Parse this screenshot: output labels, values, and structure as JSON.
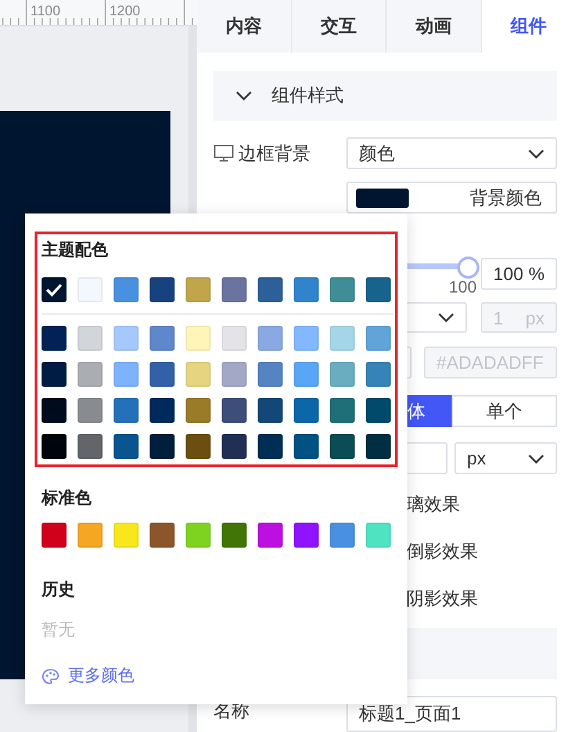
{
  "ruler": {
    "labels": [
      "1100",
      "1200"
    ]
  },
  "panel": {
    "tabs": [
      {
        "label": "内容",
        "selected": false
      },
      {
        "label": "交互",
        "selected": false
      },
      {
        "label": "动画",
        "selected": false
      },
      {
        "label": "组件",
        "selected": true
      }
    ],
    "section": {
      "title": "组件样式",
      "expanded": true
    },
    "border_bg": {
      "label": "边框背景",
      "value": "颜色"
    },
    "bg_button": {
      "label": "背景颜色",
      "color": "#001530"
    },
    "opacity": {
      "level": 1,
      "tick_label": "100",
      "value": "100",
      "unit": "%"
    },
    "border_width": {
      "value": "1",
      "unit": "px",
      "disabled": true
    },
    "color_input": {
      "placeholder": "#ADADADFF"
    },
    "segments": [
      {
        "label": "体",
        "selected": true
      },
      {
        "label": "单个",
        "selected": false
      }
    ],
    "unit_select": {
      "value": "px"
    },
    "effects": [
      "璃效果",
      "倒影效果",
      "阴影效果"
    ],
    "name_field": {
      "label": "名称",
      "value": "标题1_页面1"
    }
  },
  "picker": {
    "theme_title": "主题配色",
    "theme_rows": [
      [
        {
          "color": "#001530",
          "selected": true
        },
        {
          "color": "#f3f7fe",
          "selected": false
        },
        {
          "color": "#4a90e0",
          "selected": false
        },
        {
          "color": "#17427f",
          "selected": false
        },
        {
          "color": "#c0a54a",
          "selected": false
        },
        {
          "color": "#6b74a0",
          "selected": false
        },
        {
          "color": "#2d5f98",
          "selected": false
        },
        {
          "color": "#2f84cc",
          "selected": false
        },
        {
          "color": "#3f8e97",
          "selected": false
        },
        {
          "color": "#18628e",
          "selected": false
        }
      ],
      [
        {
          "color": "#022155",
          "selected": false
        },
        {
          "color": "#d2d5da",
          "selected": false
        },
        {
          "color": "#a5c8fd",
          "selected": false
        },
        {
          "color": "#5f87cc",
          "selected": false
        },
        {
          "color": "#fff5b8",
          "selected": false
        },
        {
          "color": "#e4e4e8",
          "selected": false
        },
        {
          "color": "#8aa9e3",
          "selected": false
        },
        {
          "color": "#82b8ff",
          "selected": false
        },
        {
          "color": "#a5d6e8",
          "selected": false
        },
        {
          "color": "#61a4da",
          "selected": false
        }
      ],
      [
        {
          "color": "#001c44",
          "selected": false
        },
        {
          "color": "#aaadb2",
          "selected": false
        },
        {
          "color": "#7eb2fd",
          "selected": false
        },
        {
          "color": "#3361a8",
          "selected": false
        },
        {
          "color": "#e6d480",
          "selected": false
        },
        {
          "color": "#a2a8c5",
          "selected": false
        },
        {
          "color": "#5683c2",
          "selected": false
        },
        {
          "color": "#5aa6f6",
          "selected": false
        },
        {
          "color": "#6badc0",
          "selected": false
        },
        {
          "color": "#3683b8",
          "selected": false
        }
      ],
      [
        {
          "color": "#000c1d",
          "selected": false
        },
        {
          "color": "#888b8f",
          "selected": false
        },
        {
          "color": "#2571b9",
          "selected": false
        },
        {
          "color": "#002a5c",
          "selected": false
        },
        {
          "color": "#9a7b28",
          "selected": false
        },
        {
          "color": "#3e4e7b",
          "selected": false
        },
        {
          "color": "#124778",
          "selected": false
        },
        {
          "color": "#0b67a8",
          "selected": false
        },
        {
          "color": "#1f6f79",
          "selected": false
        },
        {
          "color": "#004b6b",
          "selected": false
        }
      ],
      [
        {
          "color": "#00040c",
          "selected": false
        },
        {
          "color": "#626569",
          "selected": false
        },
        {
          "color": "#0a548f",
          "selected": false
        },
        {
          "color": "#001f3c",
          "selected": false
        },
        {
          "color": "#6c4f10",
          "selected": false
        },
        {
          "color": "#212f55",
          "selected": false
        },
        {
          "color": "#002f56",
          "selected": false
        },
        {
          "color": "#005283",
          "selected": false
        },
        {
          "color": "#0c4c55",
          "selected": false
        },
        {
          "color": "#002f43",
          "selected": false
        }
      ]
    ],
    "standard_title": "标准色",
    "standard": [
      {
        "color": "#d0021b",
        "selected": false
      },
      {
        "color": "#f5a623",
        "selected": false
      },
      {
        "color": "#f8e71c",
        "selected": false
      },
      {
        "color": "#8b572a",
        "selected": false
      },
      {
        "color": "#7ed321",
        "selected": false
      },
      {
        "color": "#417505",
        "selected": false
      },
      {
        "color": "#bd10e0",
        "selected": false
      },
      {
        "color": "#9013fe",
        "selected": false
      },
      {
        "color": "#4a90e2",
        "selected": false
      },
      {
        "color": "#50e3c2",
        "selected": false
      }
    ],
    "history_title": "历史",
    "history_empty": "暂无",
    "more_link": "更多颜色"
  }
}
